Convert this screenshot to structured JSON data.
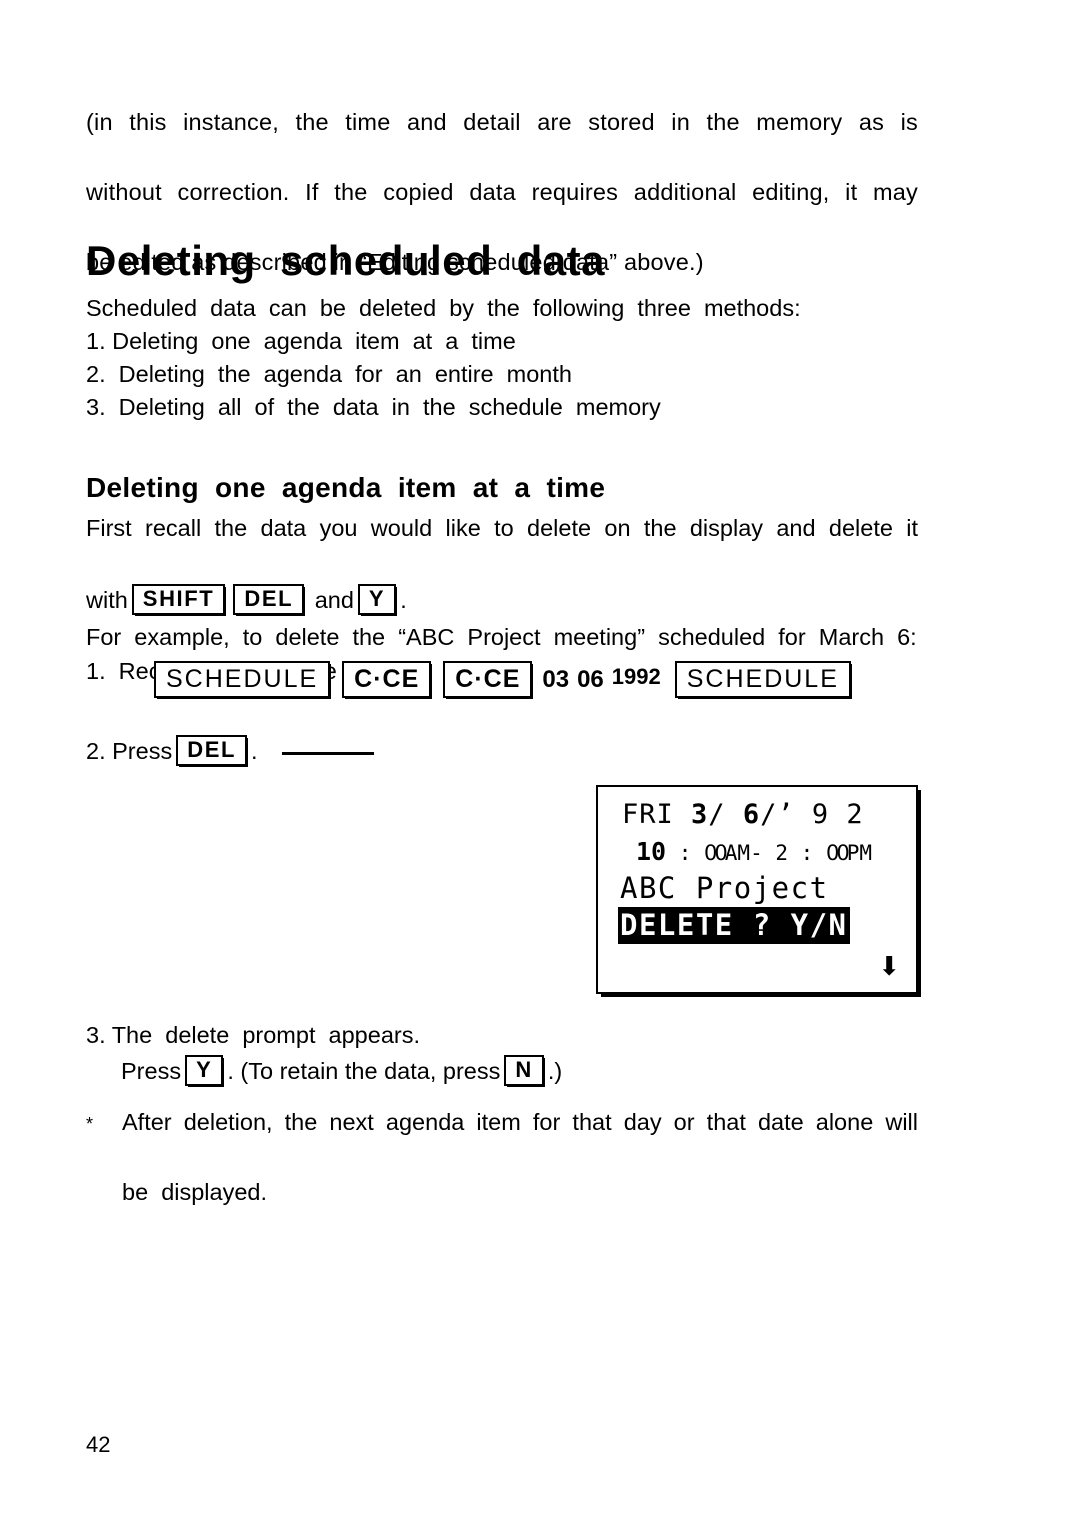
{
  "page": {
    "number": "42"
  },
  "intro": {
    "line1": "(in this instance, the time and detail are stored in the memory as is",
    "line2": "without correction. If the copied data requires additional editing, it may",
    "line3": "be edited as described in “Editing scheduled data” above.)"
  },
  "title": "Deleting  scheduled  data",
  "lead": {
    "intro_line": "Scheduled  data  can  be  deleted  by  the  following  three  methods:",
    "items": [
      "1. Deleting  one  agenda  item  at  a  time",
      "2.  Deleting  the  agenda  for  an  entire  month",
      "3.  Deleting  all  of  the  data  in  the  schedule  memory"
    ]
  },
  "subtitle": "Deleting  one  agenda  item  at  a  time",
  "section": {
    "para_line1": "First recall the data you would like to delete on the display and delete it",
    "with_prefix": "with",
    "with_key1": "SHIFT",
    "with_key2": "DEL",
    "with_and": "and",
    "with_key3": "Y",
    "with_suffix": ".",
    "example_line": "For  example,  to  delete  the  “ABC  Project  meeting”  scheduled  for  March  6:",
    "step1": "1.  Recall  the  schedule  for  that  day."
  },
  "key_sequence": {
    "key1": "SCHEDULE",
    "key2": "C·CE",
    "key3": "C·CE",
    "month": "03",
    "day": "06",
    "year": "1992",
    "key4": "SCHEDULE"
  },
  "step2": {
    "prefix": "2. Press",
    "key": "DEL",
    "suffix": "."
  },
  "lcd": {
    "date_weekday": "FRI ",
    "date_month": "3",
    "date_sep1": "/ ",
    "date_day": "6",
    "date_sep2": "/’",
    "date_year": " 9 2",
    "time_hour": "10",
    "time_rest_a": " : ",
    "time_zeros_a": "00",
    "time_ampm_a": "AM-",
    "time_hour2": " 2",
    "time_rest_b": " : ",
    "time_zeros_b": "00",
    "time_ampm_b": "PM",
    "text_line": "ABC Project",
    "prompt_line": "DELETE ? Y/N",
    "scroll_indicator": "⬇"
  },
  "step3": {
    "line1": "3. The  delete  prompt  appears.",
    "press_label": "Press",
    "key_yes": "Y",
    "mid_text": ". (To  retain  the  data,  press",
    "key_no": "N",
    "tail_text": ".)"
  },
  "footnote": {
    "marker": "*",
    "line1": "After deletion, the next agenda item for that day or that date alone will",
    "line2": "be  displayed."
  }
}
